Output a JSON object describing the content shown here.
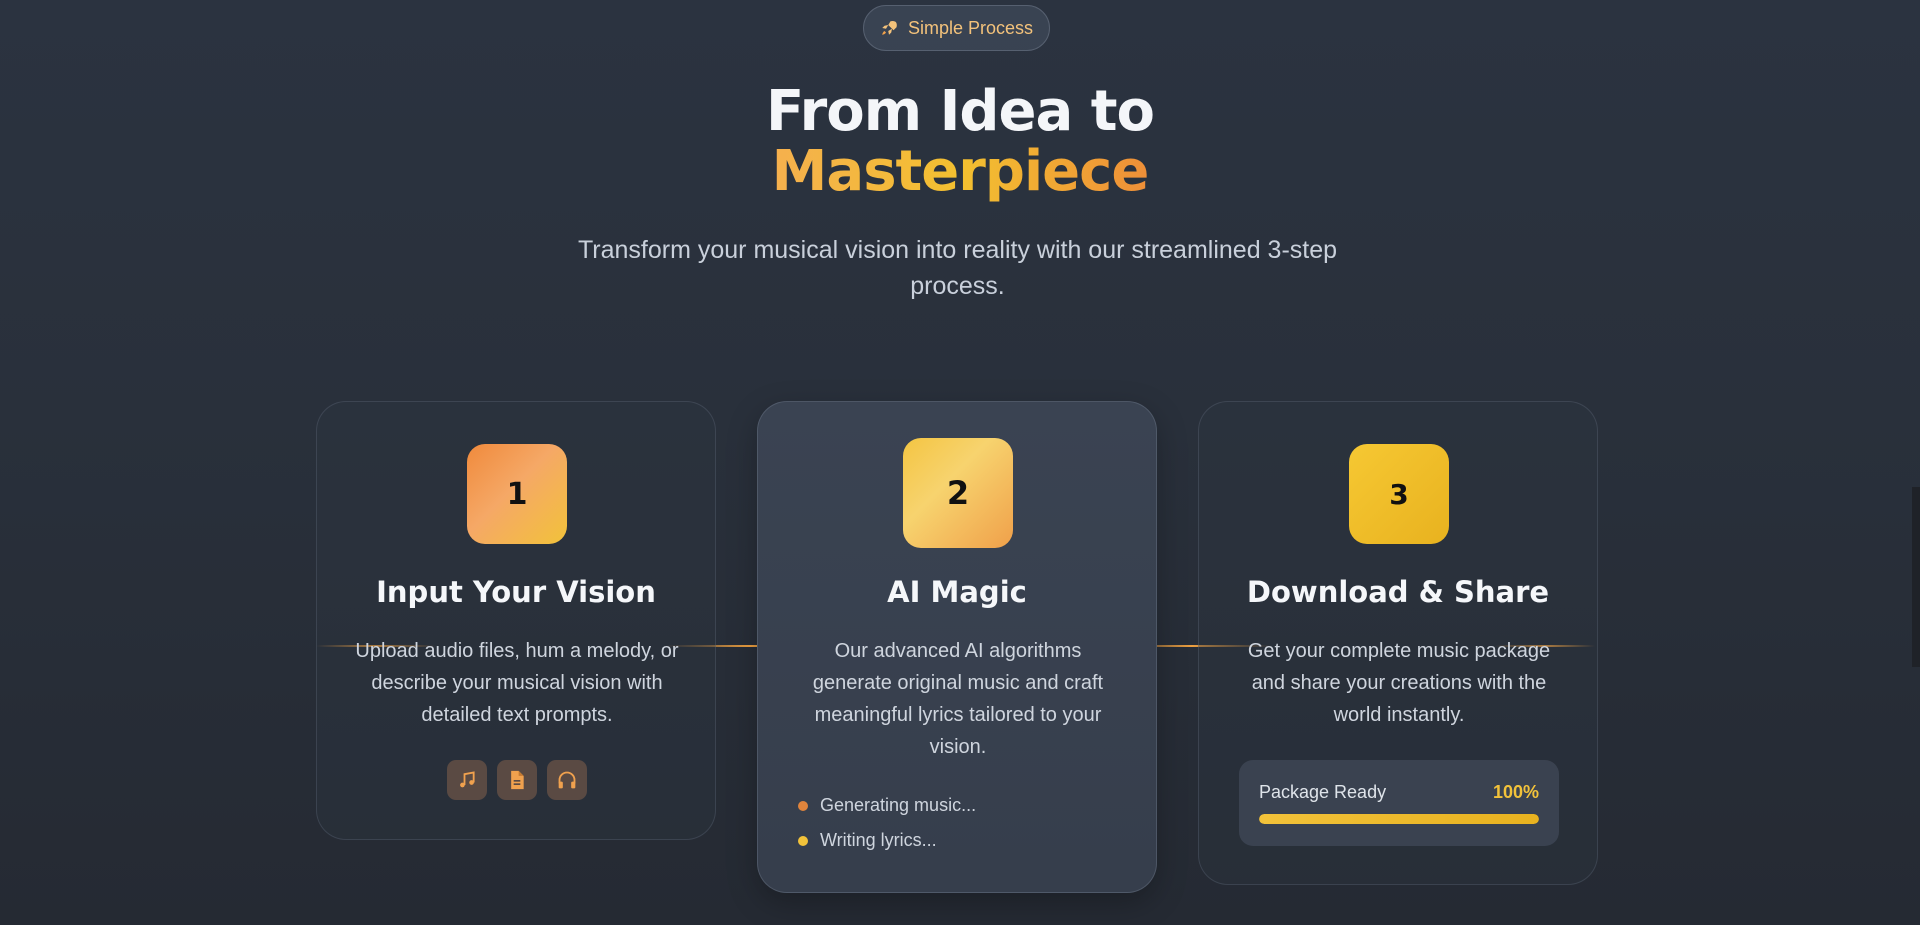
{
  "badge": {
    "label": "Simple Process",
    "icon": "rocket-icon"
  },
  "heading": {
    "line1": "From Idea to",
    "line2": "Masterpiece"
  },
  "subtitle": "Transform your musical vision into reality with our streamlined 3-step process.",
  "steps": [
    {
      "number": "1",
      "title": "Input Your Vision",
      "description": "Upload audio files, hum a melody, or describe your musical vision with detailed text prompts.",
      "icons": [
        "music-note-icon",
        "document-icon",
        "headphones-icon"
      ]
    },
    {
      "number": "2",
      "title": "AI Magic",
      "description": "Our advanced AI algorithms generate original music and craft meaningful lyrics tailored to your vision.",
      "status": [
        {
          "label": "Generating music...",
          "color": "#e0843c"
        },
        {
          "label": "Writing lyrics...",
          "color": "#f2c23a"
        }
      ]
    },
    {
      "number": "3",
      "title": "Download & Share",
      "description": "Get your complete music package and share your creations with the world instantly.",
      "package": {
        "label": "Package Ready",
        "percent_label": "100%",
        "progress": 1.0
      }
    }
  ],
  "colors": {
    "accent_orange": "#ef9a45",
    "accent_yellow": "#f2c23a",
    "background": "#29303b"
  }
}
